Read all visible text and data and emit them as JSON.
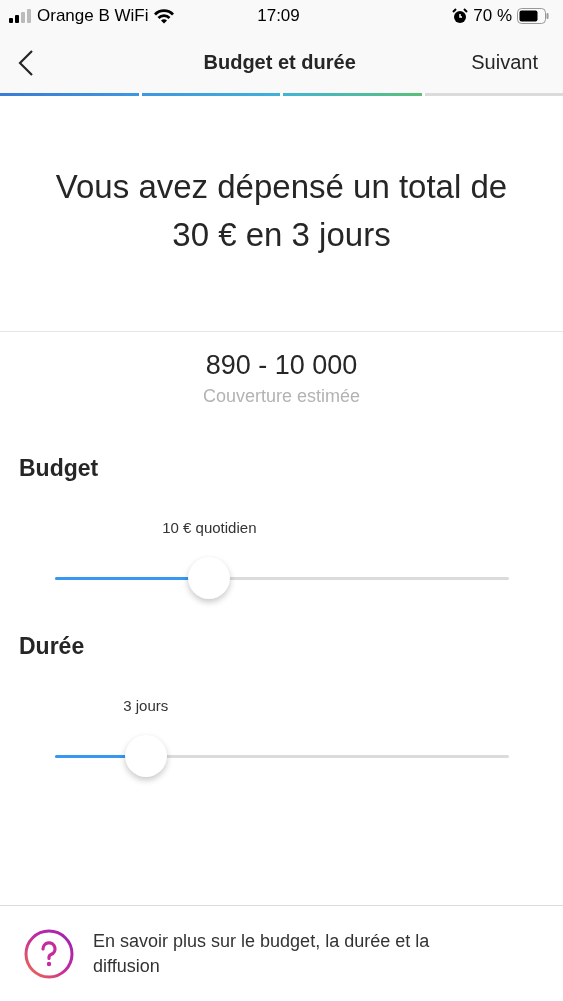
{
  "status_bar": {
    "carrier": "Orange B WiFi",
    "time": "17:09",
    "battery": "70 %"
  },
  "header": {
    "title": "Budget et durée",
    "next": "Suivant"
  },
  "progress_steps": [
    {
      "done": true
    },
    {
      "done": true
    },
    {
      "done": true
    },
    {
      "done": false
    }
  ],
  "summary": "Vous avez dépensé un total de 30 € en 3 jours",
  "reach": {
    "value": "890 - 10 000",
    "label": "Couverture estimée"
  },
  "sliders": [
    {
      "title": "Budget",
      "reading": "10 € quotidien",
      "level": 0.34
    },
    {
      "title": "Durée",
      "reading": "3 jours",
      "level": 0.2
    }
  ],
  "help_link": "En savoir plus sur le budget, la durée et la diffusion"
}
